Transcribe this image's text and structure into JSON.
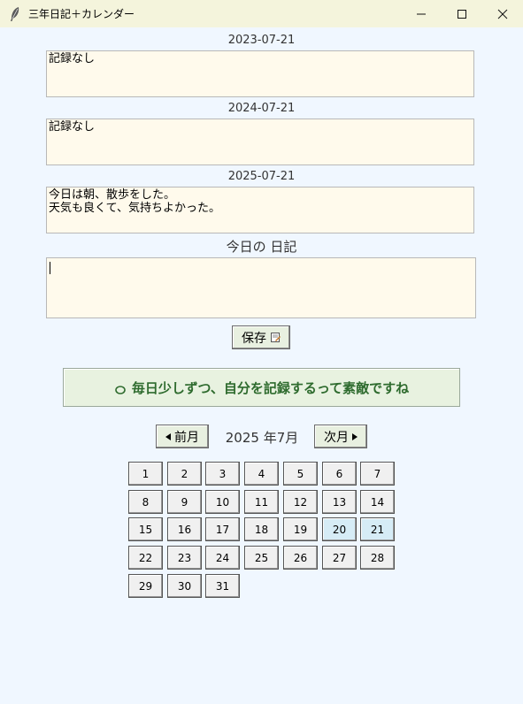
{
  "window": {
    "title": "三年日記＋カレンダー",
    "icon": "feather-icon",
    "controls": {
      "minimize": "—",
      "maximize": "☐",
      "close": "✕"
    }
  },
  "entries": [
    {
      "date": "2023-07-21",
      "text": "記録なし"
    },
    {
      "date": "2024-07-21",
      "text": "記録なし"
    },
    {
      "date": "2025-07-21",
      "text": "今日は朝、散歩をした。\n天気も良くて、気持ちよかった。"
    }
  ],
  "today": {
    "label": "今日の 日記",
    "value": ""
  },
  "save_button": {
    "label": "保存",
    "icon": "save-icon"
  },
  "message": {
    "text": "毎日少しずつ、自分を記録するって素敵ですね",
    "icon": "leaf-icon"
  },
  "calendar": {
    "prev_label": "前月",
    "next_label": "次月",
    "month_label": "2025 年7月",
    "days": [
      "1",
      "2",
      "3",
      "4",
      "5",
      "6",
      "7",
      "8",
      "9",
      "10",
      "11",
      "12",
      "13",
      "14",
      "15",
      "16",
      "17",
      "18",
      "19",
      "20",
      "21",
      "22",
      "23",
      "24",
      "25",
      "26",
      "27",
      "28",
      "29",
      "30",
      "31"
    ],
    "highlighted_days": [
      "20",
      "21"
    ],
    "highlight_color": "#d6ecf6"
  },
  "colors": {
    "background": "#f0f7ff",
    "titlebar": "#f4f4dc",
    "entry_bg": "#fffaec",
    "message_text": "#2e6b2e"
  }
}
